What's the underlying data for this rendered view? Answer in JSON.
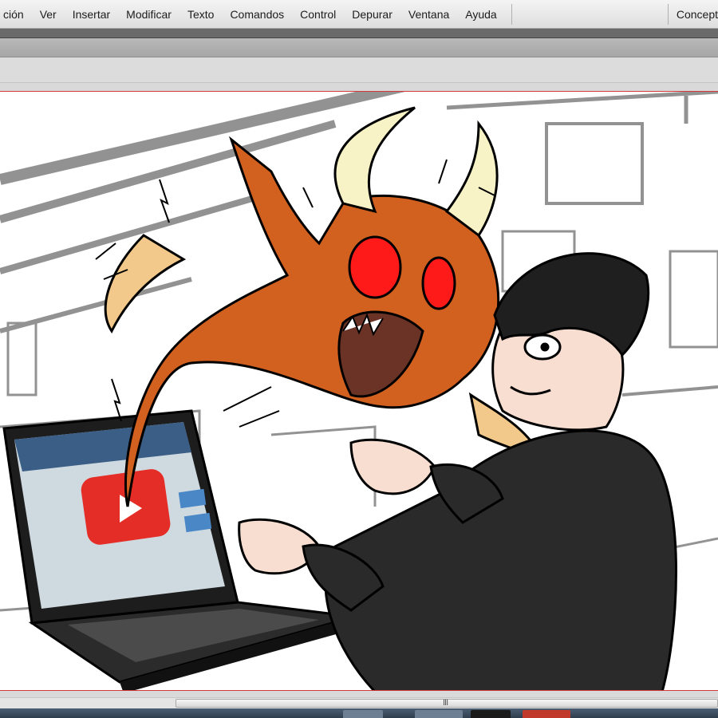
{
  "menubar": {
    "items": [
      "ción",
      "Ver",
      "Insertar",
      "Modificar",
      "Texto",
      "Comandos",
      "Control",
      "Depurar",
      "Ventana",
      "Ayuda"
    ],
    "workspace": "Concept"
  },
  "scrollbar": {
    "grip": "III"
  },
  "colors": {
    "stage_border": "#d23a3a",
    "monster": "#d2601f",
    "monster_eyes": "#ff1a1a",
    "horns": "#f7f3c6",
    "claws": "#f2c98a",
    "hoodie": "#2a2a2a",
    "hair": "#1f1f1f",
    "skin": "#f7ded0",
    "youtube_red": "#e52d27"
  }
}
